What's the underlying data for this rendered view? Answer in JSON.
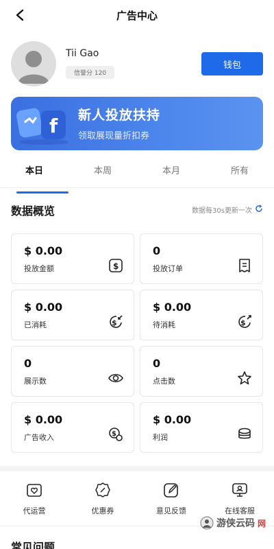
{
  "header": {
    "title": "广告中心",
    "back_icon": "back-arrow-icon"
  },
  "profile": {
    "name": "Tii Gao",
    "credit": "信誉分 120",
    "wallet_label": "钱包"
  },
  "banner": {
    "title": "新人投放扶持",
    "subtitle": "领取展现量折扣券",
    "art_letter": "f"
  },
  "tabs": [
    {
      "label": "本日",
      "active": true
    },
    {
      "label": "本周",
      "active": false
    },
    {
      "label": "本月",
      "active": false
    },
    {
      "label": "所有",
      "active": false
    }
  ],
  "overview": {
    "title": "数据概览",
    "refresh_note": "数据每30s更新一次"
  },
  "stats": [
    {
      "value": "$ 0.00",
      "label": "投放金额",
      "icon": "dollar-box-icon"
    },
    {
      "value": "0",
      "label": "投放订单",
      "icon": "receipt-icon"
    },
    {
      "value": "$ 0.00",
      "label": "已消耗",
      "icon": "dollar-out-icon"
    },
    {
      "value": "$ 0.00",
      "label": "待消耗",
      "icon": "dollar-pending-icon"
    },
    {
      "value": "0",
      "label": "展示数",
      "icon": "eye-icon"
    },
    {
      "value": "0",
      "label": "点击数",
      "icon": "star-click-icon"
    },
    {
      "value": "$ 0.00",
      "label": "广告收入",
      "icon": "coin-icon"
    },
    {
      "value": "$ 0.00",
      "label": "利润",
      "icon": "coin-stack-icon"
    }
  ],
  "tools": [
    {
      "label": "代运营",
      "icon": "folder-heart-icon"
    },
    {
      "label": "优惠券",
      "icon": "coupon-badge-icon"
    },
    {
      "label": "意见反馈",
      "icon": "edit-icon"
    },
    {
      "label": "在线客服",
      "icon": "support-icon"
    }
  ],
  "faq": {
    "title": "常见问题"
  },
  "watermark": {
    "text": "游侠云码",
    "suffix": "网"
  },
  "colors": {
    "accent": "#1e6ae8",
    "banner": "#4478e6"
  }
}
